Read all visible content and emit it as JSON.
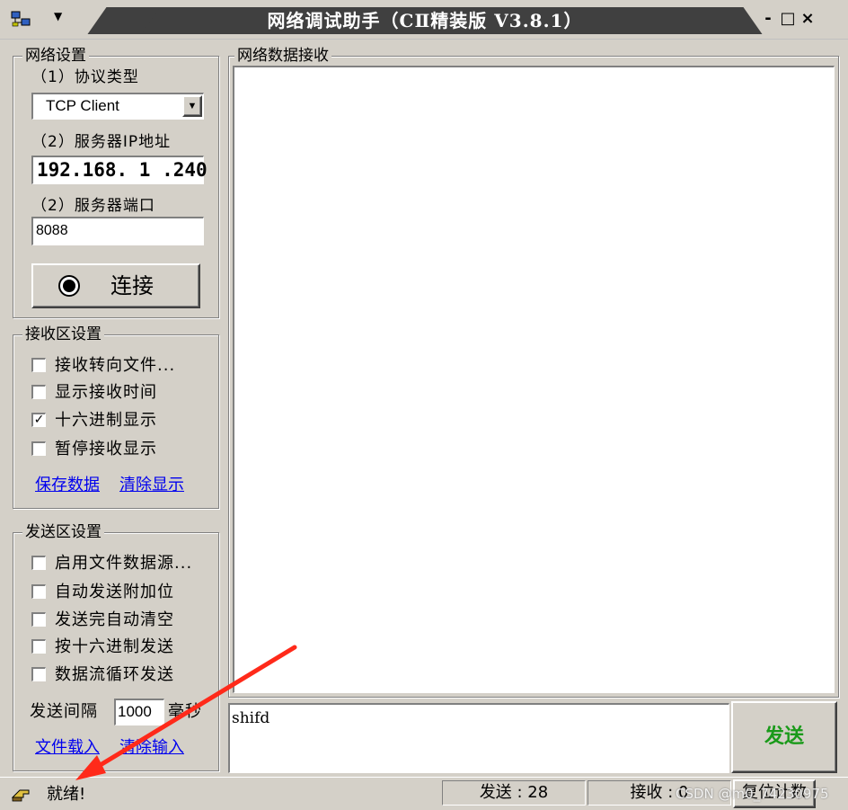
{
  "window": {
    "title": "网络调试助手（CⅡ精装版 V3.8.1）",
    "controls": [
      "-",
      "□",
      "×"
    ]
  },
  "net_settings": {
    "title": "网络设置",
    "protocol_label": "（1）协议类型",
    "protocol_value": "TCP Client",
    "ip_label": "（2）服务器IP地址",
    "ip_value": "192.168. 1 .240",
    "port_label": "（2）服务器端口",
    "port_value": "8088",
    "connect_label": "连接"
  },
  "recv_settings": {
    "title": "接收区设置",
    "options": [
      {
        "label": "接收转向文件...",
        "checked": false
      },
      {
        "label": "显示接收时间",
        "checked": false
      },
      {
        "label": "十六进制显示",
        "checked": true
      },
      {
        "label": "暂停接收显示",
        "checked": false
      }
    ],
    "save_link": "保存数据",
    "clear_link": "清除显示"
  },
  "send_settings": {
    "title": "发送区设置",
    "options": [
      {
        "label": "启用文件数据源...",
        "checked": false
      },
      {
        "label": "自动发送附加位",
        "checked": false
      },
      {
        "label": "发送完自动清空",
        "checked": false
      },
      {
        "label": "按十六进制发送",
        "checked": false
      },
      {
        "label": "数据流循环发送",
        "checked": false
      }
    ],
    "interval_label": "发送间隔",
    "interval_value": "1000",
    "interval_unit": "毫秒",
    "load_link": "文件载入",
    "clear_input_link": "清除输入"
  },
  "receive_area": {
    "title": "网络数据接收",
    "content": ""
  },
  "send_area": {
    "input_value": "shifd",
    "send_label": "发送"
  },
  "status_bar": {
    "status_text": "就绪!",
    "sent_label": "发送",
    "sent_value": "28",
    "recv_label": "接收",
    "recv_value": "0",
    "reset_label": "复位计数"
  },
  "watermark": "CSDN @m0_74230975",
  "colors": {
    "face": "#d4d0c8",
    "title_bar": "#404040",
    "link": "#0000ee",
    "send_button_text": "#1a9a1a",
    "annotation_arrow": "#ff2a1a"
  }
}
